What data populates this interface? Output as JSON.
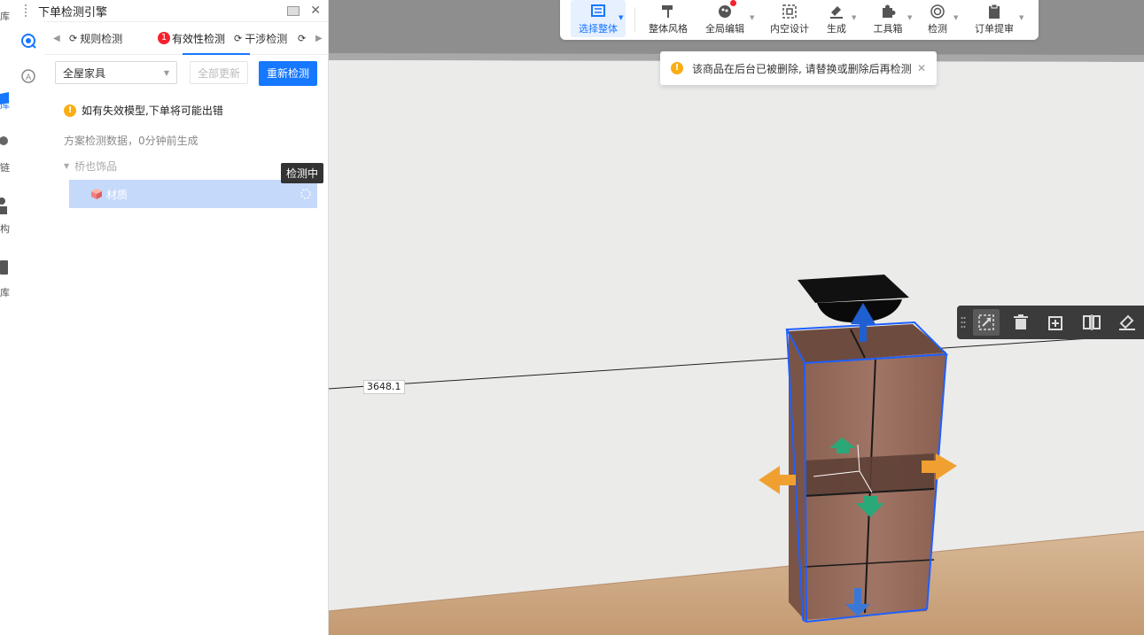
{
  "panel": {
    "title": "下单检测引擎",
    "close_glyph": "✕",
    "tabs": [
      {
        "label": "规则检测"
      },
      {
        "label": "有效性检测",
        "badge": "1"
      },
      {
        "label": "干涉检测"
      }
    ],
    "scope_select": "全屋家具",
    "update_all_label": "全部更新",
    "recheck_label": "重新检测",
    "warning_text": "如有失效模型,下单将可能出错",
    "meta_text": "方案检测数据，0分钟前生成",
    "tree": {
      "parent_label": "桥也饰品",
      "child_label": "材质"
    },
    "tooltip": "检测中"
  },
  "rail": {
    "fragments": [
      "库",
      "库",
      "链",
      "构",
      "库"
    ]
  },
  "topbar": {
    "items": [
      {
        "label": "选择整体",
        "icon": "select-whole-icon"
      },
      {
        "label": "整体风格",
        "icon": "paint-roller-icon"
      },
      {
        "label": "全局编辑",
        "icon": "palette-icon"
      },
      {
        "label": "内空设计",
        "icon": "inner-space-icon"
      },
      {
        "label": "生成",
        "icon": "hammer-icon"
      },
      {
        "label": "工具箱",
        "icon": "puzzle-icon"
      },
      {
        "label": "检测",
        "icon": "target-icon"
      },
      {
        "label": "订单提审",
        "icon": "clipboard-icon"
      }
    ]
  },
  "notice": {
    "text": "该商品在后台已被删除, 请替换或删除后再检测",
    "close_glyph": "✕"
  },
  "scene": {
    "dimension": "3648.1"
  },
  "colors": {
    "primary": "#1677ff",
    "warning": "#faad14",
    "danger": "#f5222d"
  }
}
